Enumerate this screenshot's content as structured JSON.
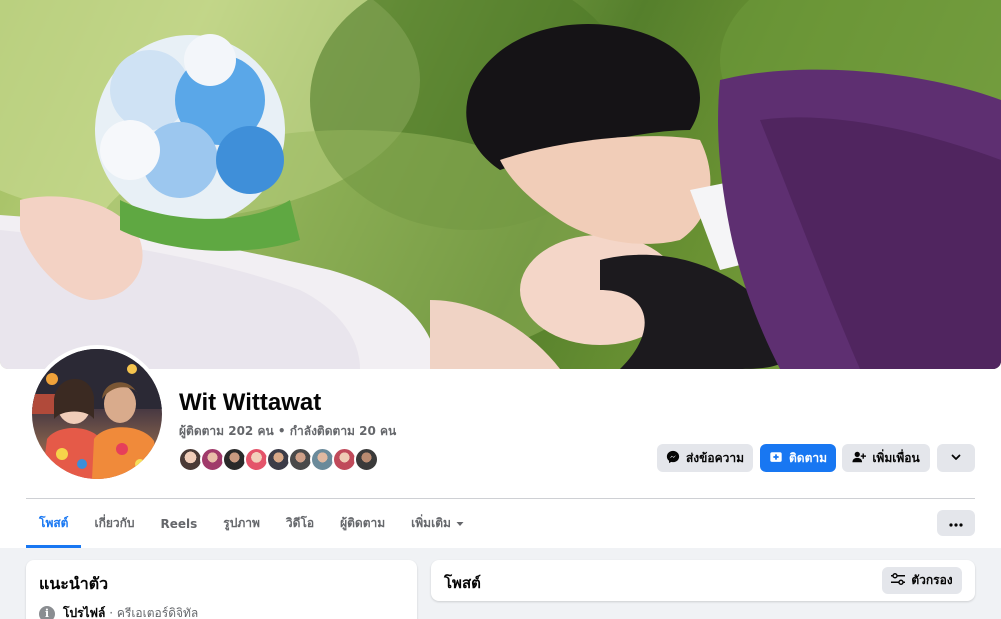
{
  "profile": {
    "name": "Wit Wittawat",
    "stats": "ผู้ติดตาม 202 คน • กำลังติดตาม 20 คน"
  },
  "actions": {
    "message_label": "ส่งข้อความ",
    "follow_label": "ติดตาม",
    "add_friend_label": "เพิ่มเพื่อน"
  },
  "tabs": [
    {
      "label": "โพสต์"
    },
    {
      "label": "เกี่ยวกับ"
    },
    {
      "label": "Reels"
    },
    {
      "label": "รูปภาพ"
    },
    {
      "label": "วิดีโอ"
    },
    {
      "label": "ผู้ติดตาม"
    },
    {
      "label": "เพิ่มเติม"
    }
  ],
  "intro": {
    "title": "แนะนำตัว",
    "profile_label": "โปรไฟล์",
    "profile_category": "ครีเอเตอร์ดิจิทัล"
  },
  "posts": {
    "title": "โพสต์",
    "filter_label": "ตัวกรอง"
  },
  "colors": {
    "accent": "#1877f2",
    "background": "#f0f2f5",
    "button_gray": "#e4e6eb"
  }
}
